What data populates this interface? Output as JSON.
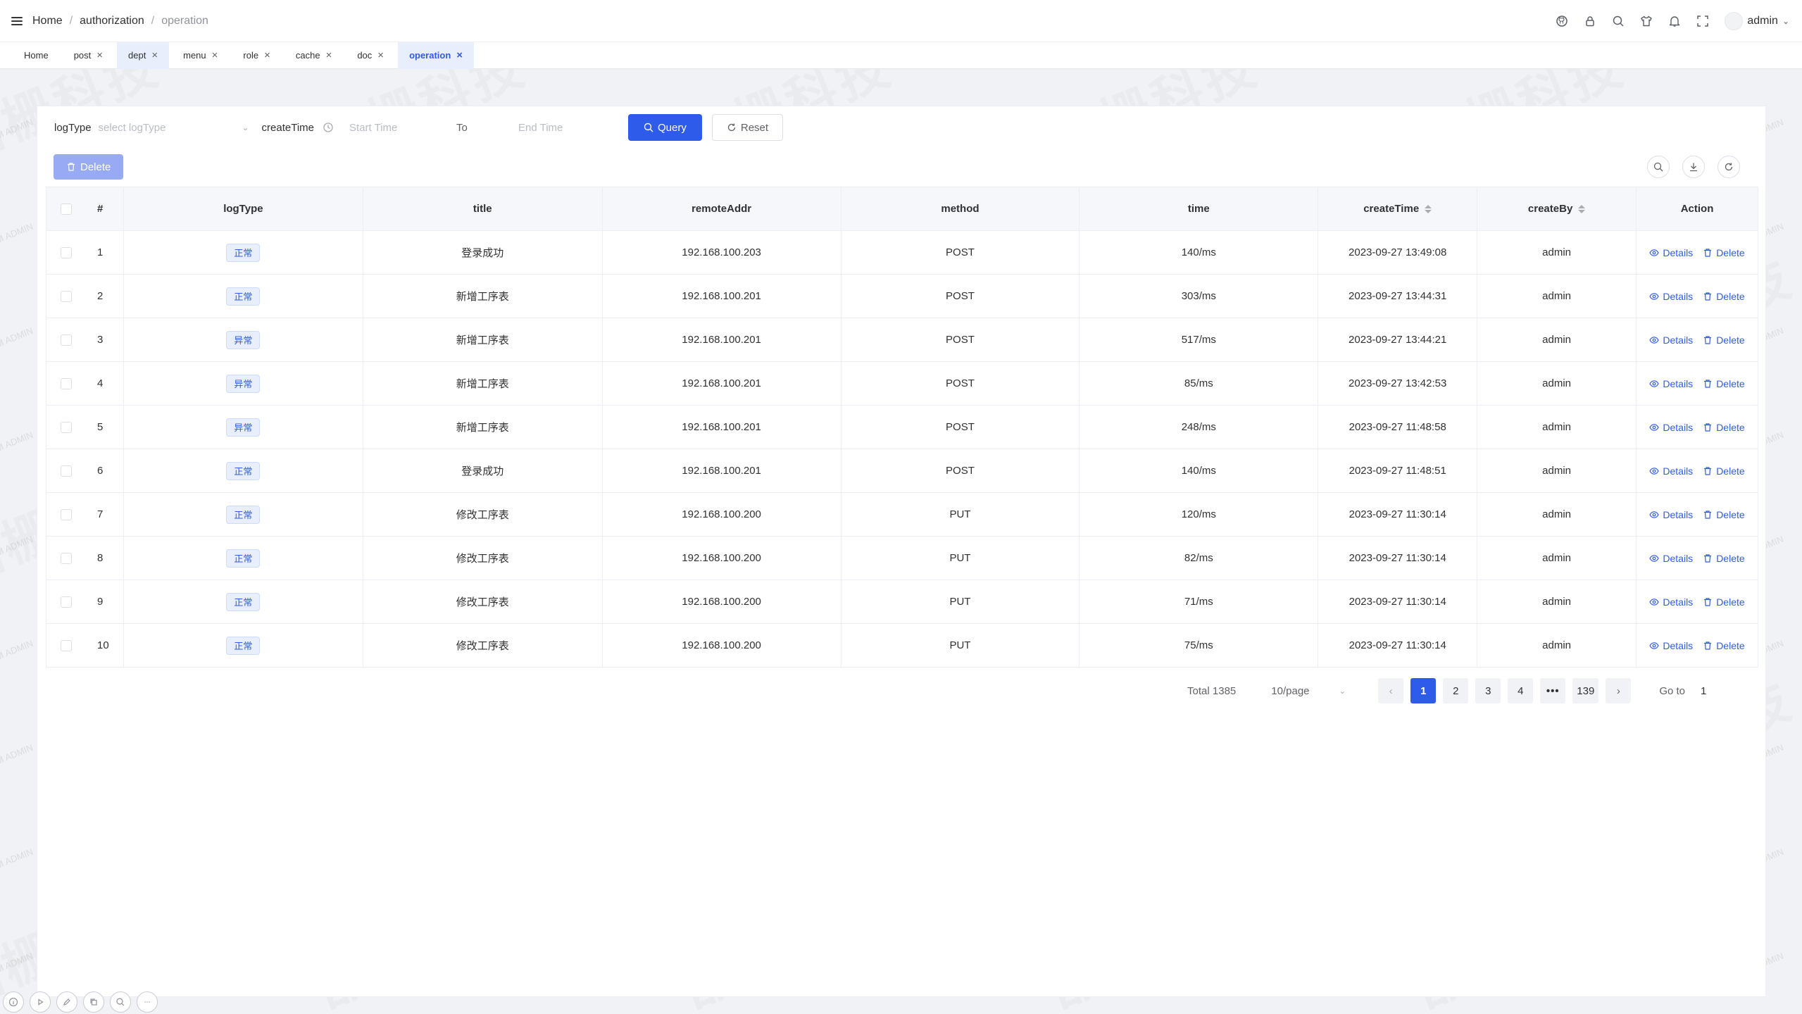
{
  "header": {
    "breadcrumb": [
      "Home",
      "authorization",
      "operation"
    ],
    "user": "admin",
    "icons": [
      "github-icon",
      "lock-icon",
      "search-icon",
      "theme-icon",
      "bell-icon",
      "fullscreen-icon"
    ]
  },
  "tabs": [
    {
      "label": "Home",
      "closable": false
    },
    {
      "label": "post",
      "closable": true
    },
    {
      "label": "dept",
      "closable": true
    },
    {
      "label": "menu",
      "closable": true
    },
    {
      "label": "role",
      "closable": true
    },
    {
      "label": "cache",
      "closable": true
    },
    {
      "label": "doc",
      "closable": true
    },
    {
      "label": "operation",
      "closable": true
    }
  ],
  "search": {
    "logtype_label": "logType",
    "logtype_placeholder": "select logType",
    "createtime_label": "createTime",
    "start_placeholder": "Start Time",
    "to": "To",
    "end_placeholder": "End Time",
    "query_label": "Query",
    "reset_label": "Reset"
  },
  "toolbar": {
    "delete_label": "Delete"
  },
  "table": {
    "headers": {
      "index": "#",
      "logType": "logType",
      "title": "title",
      "remoteAddr": "remoteAddr",
      "method": "method",
      "time": "time",
      "createTime": "createTime",
      "createBy": "createBy",
      "action": "Action"
    },
    "details_label": "Details",
    "delete_label": "Delete",
    "rows": [
      {
        "index": "1",
        "logType": "正常",
        "title": "登录成功",
        "remoteAddr": "192.168.100.203",
        "method": "POST",
        "time": "140/ms",
        "createTime": "2023-09-27 13:49:08",
        "createBy": "admin"
      },
      {
        "index": "2",
        "logType": "正常",
        "title": "新增工序表",
        "remoteAddr": "192.168.100.201",
        "method": "POST",
        "time": "303/ms",
        "createTime": "2023-09-27 13:44:31",
        "createBy": "admin"
      },
      {
        "index": "3",
        "logType": "异常",
        "title": "新增工序表",
        "remoteAddr": "192.168.100.201",
        "method": "POST",
        "time": "517/ms",
        "createTime": "2023-09-27 13:44:21",
        "createBy": "admin"
      },
      {
        "index": "4",
        "logType": "异常",
        "title": "新增工序表",
        "remoteAddr": "192.168.100.201",
        "method": "POST",
        "time": "85/ms",
        "createTime": "2023-09-27 13:42:53",
        "createBy": "admin"
      },
      {
        "index": "5",
        "logType": "异常",
        "title": "新增工序表",
        "remoteAddr": "192.168.100.201",
        "method": "POST",
        "time": "248/ms",
        "createTime": "2023-09-27 11:48:58",
        "createBy": "admin"
      },
      {
        "index": "6",
        "logType": "正常",
        "title": "登录成功",
        "remoteAddr": "192.168.100.201",
        "method": "POST",
        "time": "140/ms",
        "createTime": "2023-09-27 11:48:51",
        "createBy": "admin"
      },
      {
        "index": "7",
        "logType": "正常",
        "title": "修改工序表",
        "remoteAddr": "192.168.100.200",
        "method": "PUT",
        "time": "120/ms",
        "createTime": "2023-09-27 11:30:14",
        "createBy": "admin"
      },
      {
        "index": "8",
        "logType": "正常",
        "title": "修改工序表",
        "remoteAddr": "192.168.100.200",
        "method": "PUT",
        "time": "82/ms",
        "createTime": "2023-09-27 11:30:14",
        "createBy": "admin"
      },
      {
        "index": "9",
        "logType": "正常",
        "title": "修改工序表",
        "remoteAddr": "192.168.100.200",
        "method": "PUT",
        "time": "71/ms",
        "createTime": "2023-09-27 11:30:14",
        "createBy": "admin"
      },
      {
        "index": "10",
        "logType": "正常",
        "title": "修改工序表",
        "remoteAddr": "192.168.100.200",
        "method": "PUT",
        "time": "75/ms",
        "createTime": "2023-09-27 11:30:14",
        "createBy": "admin"
      }
    ]
  },
  "pagination": {
    "total": "Total 1385",
    "page_size": "10/page",
    "pages": [
      "1",
      "2",
      "3",
      "4",
      "•••",
      "139"
    ],
    "active_page": "1",
    "goto_label": "Go to",
    "goto_value": "1"
  },
  "watermark": {
    "big": "晶栅科技",
    "small": "CIM ADMIN"
  },
  "colors": {
    "primary": "#2f5bea",
    "tag_bg": "#e8eefc"
  }
}
